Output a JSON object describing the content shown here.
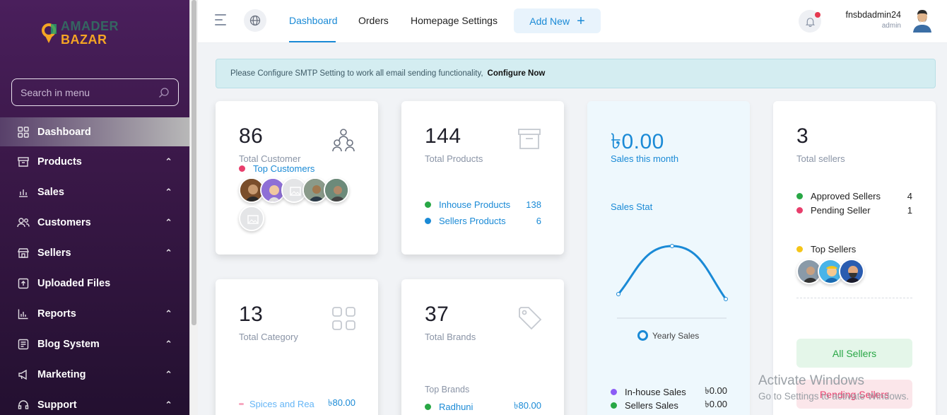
{
  "sidebar": {
    "logo_line1": "AMADER",
    "logo_line2": "BAZAR",
    "search_placeholder": "Search in menu",
    "items": [
      {
        "label": "Dashboard",
        "icon": "grid-icon"
      },
      {
        "label": "Products",
        "icon": "archive-icon"
      },
      {
        "label": "Sales",
        "icon": "chart-bars-icon"
      },
      {
        "label": "Customers",
        "icon": "users-icon"
      },
      {
        "label": "Sellers",
        "icon": "store-icon"
      },
      {
        "label": "Uploaded Files",
        "icon": "upload-icon"
      },
      {
        "label": "Reports",
        "icon": "bar-chart-icon"
      },
      {
        "label": "Blog System",
        "icon": "blog-icon"
      },
      {
        "label": "Marketing",
        "icon": "megaphone-icon"
      },
      {
        "label": "Support",
        "icon": "support-icon"
      }
    ]
  },
  "topbar": {
    "tabs": [
      "Dashboard",
      "Orders",
      "Homepage Settings"
    ],
    "add_new": "Add New",
    "user_name": "fnsbdadmin24",
    "user_role": "admin"
  },
  "alert": {
    "text": "Please Configure SMTP Setting to work all email sending functionality,",
    "link": "Configure Now"
  },
  "cards": {
    "customers": {
      "value": "86",
      "label": "Total Customer",
      "top_label": "Top Customers"
    },
    "products": {
      "value": "144",
      "label": "Total Products",
      "inhouse_label": "Inhouse Products",
      "inhouse_value": "138",
      "sellers_label": "Sellers Products",
      "sellers_value": "6"
    },
    "sales": {
      "value": "৳0.00",
      "label": "Sales this month",
      "stat_label": "Sales Stat",
      "legend": "Yearly Sales",
      "inhouse_label": "In-house Sales",
      "inhouse_value": "৳0.00",
      "sellers_label": "Sellers Sales",
      "sellers_value": "৳0.00"
    },
    "sellers": {
      "value": "3",
      "label": "Total sellers",
      "approved_label": "Approved Sellers",
      "approved_value": "4",
      "pending_label": "Pending Seller",
      "pending_value": "1",
      "top_label": "Top Sellers",
      "all_btn": "All Sellers",
      "pending_btn": "Pending Sellers"
    },
    "category": {
      "value": "13",
      "label": "Total Category",
      "item_label": "Spices and Rea",
      "item_value": "৳80.00"
    },
    "brands": {
      "value": "37",
      "label": "Total Brands",
      "top_label": "Top Brands",
      "item_label": "Radhuni",
      "item_value": "৳80.00"
    }
  },
  "colors": {
    "accent": "#1a8ad6",
    "green": "#28a745",
    "pink": "#e83e6c",
    "yellow": "#f5c518",
    "purple": "#8b5cf6"
  },
  "chart_data": {
    "type": "line",
    "title": "Sales Stat",
    "series": [
      {
        "name": "Yearly Sales",
        "values": [
          0,
          0,
          0
        ]
      }
    ],
    "x": [
      "",
      "",
      ""
    ],
    "legend": "bottom",
    "grid": false
  },
  "watermark": {
    "line1": "Activate Windows",
    "line2": "Go to Settings to activate Windows."
  }
}
